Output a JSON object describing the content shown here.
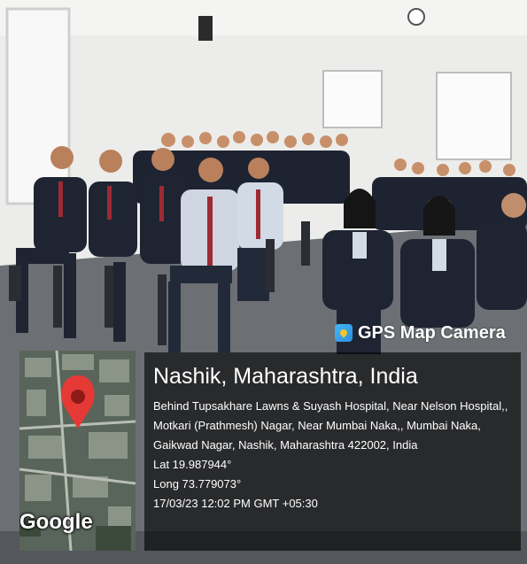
{
  "overlay": {
    "app_name": "GPS Map Camera",
    "app_icon": "gps-map-pin-icon",
    "map_attribution": "Google",
    "location_title": "Nashik, Maharashtra, India",
    "address": "Behind Tupsakhare Lawns & Suyash Hospital, Near Nelson Hospital,, Motkari (Prathmesh) Nagar, Near Mumbai Naka,, Mumbai Naka, Gaikwad Nagar, Nashik, Maharashtra 422002, India",
    "latitude": "Lat 19.987944°",
    "longitude": "Long 73.779073°",
    "timestamp": "17/03/23 12:02 PM GMT +05:30"
  },
  "colors": {
    "wall": "#ebebe8",
    "floor": "#6b6e72",
    "blazer": "#1f2433",
    "panel": "#000000",
    "map_marker": "#e53935"
  }
}
